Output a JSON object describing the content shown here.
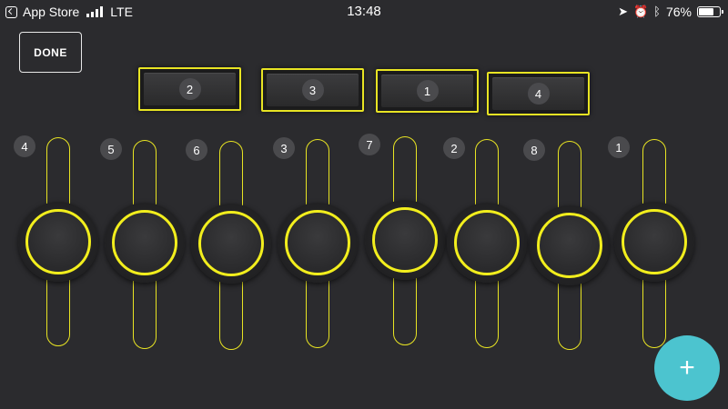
{
  "status_bar": {
    "back_app": "App Store",
    "network": "LTE",
    "time": "13:48",
    "battery_percent": "76%",
    "battery_level": 0.76,
    "icons": [
      "location-icon",
      "alarm-icon",
      "bluetooth-icon"
    ]
  },
  "toolbar": {
    "done_label": "DONE"
  },
  "pads": [
    {
      "number": "2"
    },
    {
      "number": "3"
    },
    {
      "number": "1"
    },
    {
      "number": "4"
    }
  ],
  "sliders": [
    {
      "number": "4"
    },
    {
      "number": "5"
    },
    {
      "number": "6"
    },
    {
      "number": "3"
    },
    {
      "number": "7"
    },
    {
      "number": "2"
    },
    {
      "number": "8"
    },
    {
      "number": "1"
    }
  ],
  "fab": {
    "label": "+"
  },
  "colors": {
    "accent": "#e8e423",
    "background": "#2b2b2e",
    "fab": "#4cc4cf"
  }
}
